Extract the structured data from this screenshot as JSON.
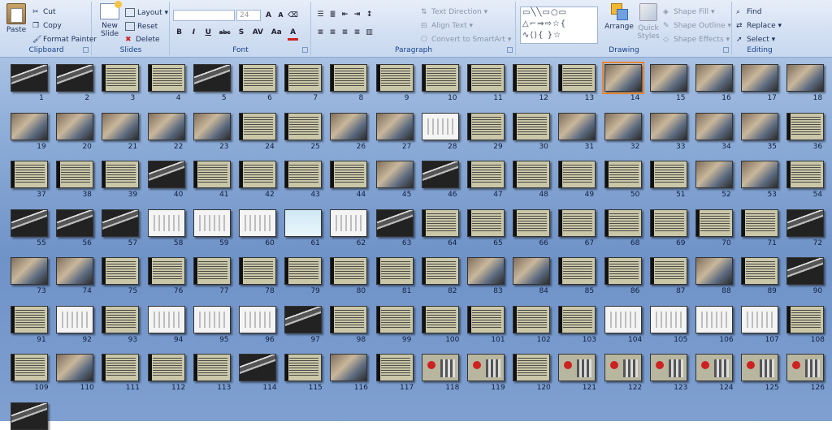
{
  "clipboard": {
    "label": "Clipboard",
    "paste": "Paste",
    "cut": "Cut",
    "copy": "Copy",
    "format_painter": "Format Painter"
  },
  "slides_group": {
    "label": "Slides",
    "new_slide": "New",
    "new_slide2": "Slide",
    "layout": "Layout",
    "reset": "Reset",
    "delete": "Delete"
  },
  "font": {
    "label": "Font",
    "size": "24",
    "buttons": [
      "B",
      "I",
      "U",
      "abc",
      "S",
      "AV",
      "Aa",
      "A"
    ]
  },
  "paragraph": {
    "label": "Paragraph",
    "text_direction": "Text Direction",
    "align_text": "Align Text",
    "convert_smartart": "Convert to SmartArt"
  },
  "drawing": {
    "label": "Drawing",
    "arrange": "Arrange",
    "quick_styles": "Quick",
    "quick_styles2": "Styles",
    "shape_fill": "Shape Fill",
    "shape_outline": "Shape Outline",
    "shape_effects": "Shape Effects"
  },
  "editing": {
    "label": "Editing",
    "find": "Find",
    "replace": "Replace",
    "select": "Select"
  },
  "colors": {
    "accent": "#15428b",
    "selection": "#e8852e"
  },
  "slides": {
    "count": 127,
    "selected": 14
  }
}
